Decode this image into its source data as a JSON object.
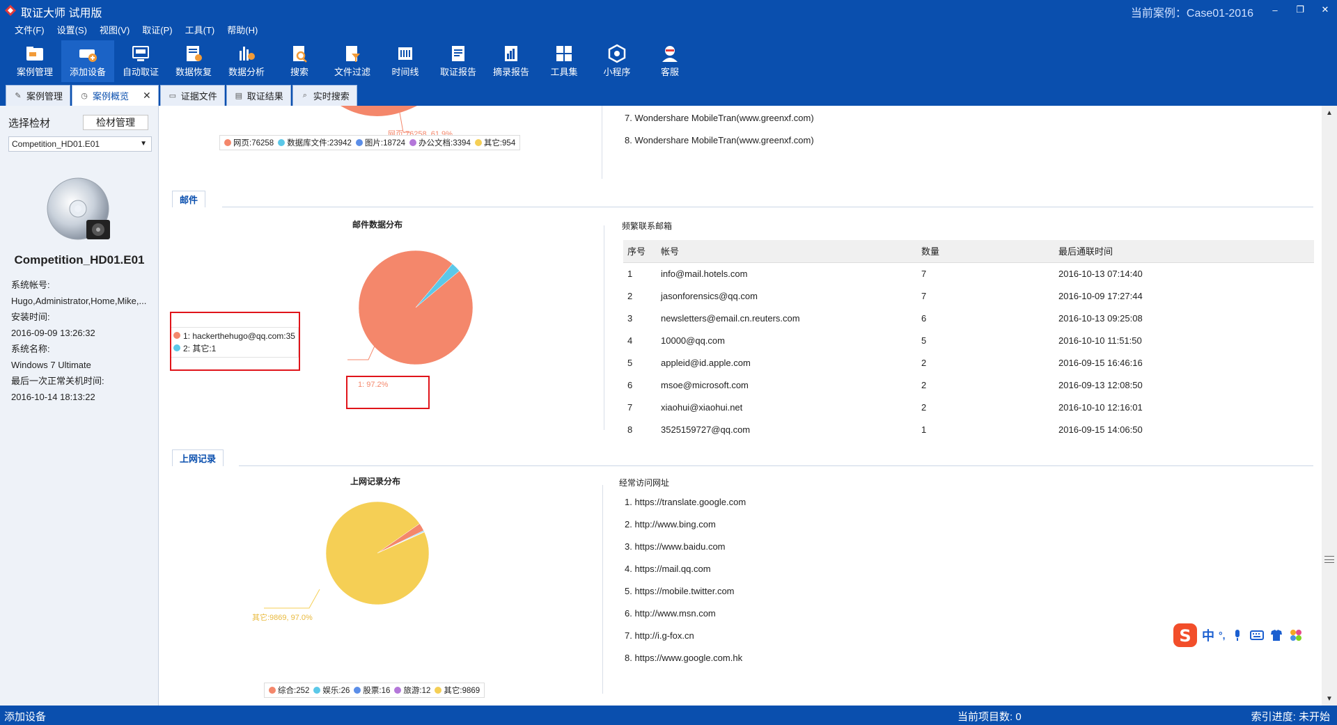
{
  "app": {
    "title": "取证大师 试用版",
    "current_case": "当前案例：Case01-2016",
    "win_buttons": {
      "minimize": "–",
      "restore": "❐",
      "close": "✕"
    }
  },
  "menu": [
    "文件(F)",
    "设置(S)",
    "视图(V)",
    "取证(P)",
    "工具(T)",
    "帮助(H)"
  ],
  "toolbar": [
    {
      "label": "案例管理",
      "icon": "case-management-icon"
    },
    {
      "label": "添加设备",
      "icon": "add-device-icon"
    },
    {
      "label": "自动取证",
      "icon": "auto-forensics-icon"
    },
    {
      "label": "数据恢复",
      "icon": "data-recovery-icon"
    },
    {
      "label": "数据分析",
      "icon": "data-analysis-icon"
    },
    {
      "label": "搜索",
      "icon": "search-icon"
    },
    {
      "label": "文件过滤",
      "icon": "file-filter-icon"
    },
    {
      "label": "时间线",
      "icon": "timeline-icon"
    },
    {
      "label": "取证报告",
      "icon": "forensics-report-icon"
    },
    {
      "label": "摘录报告",
      "icon": "excerpt-report-icon"
    },
    {
      "label": "工具集",
      "icon": "toolset-icon"
    },
    {
      "label": "小程序",
      "icon": "miniprogram-icon"
    },
    {
      "label": "客服",
      "icon": "customer-service-icon"
    }
  ],
  "tabs": [
    {
      "label": "案例管理"
    },
    {
      "label": "案例概览",
      "close": "✕"
    },
    {
      "label": "证据文件"
    },
    {
      "label": "取证结果"
    },
    {
      "label": "实时搜索"
    }
  ],
  "left": {
    "select_label": "选择检材",
    "manage_button": "检材管理",
    "dropdown_value": "Competition_HD01.E01",
    "device_name": "Competition_HD01.E01",
    "info": [
      "系统帐号:",
      "Hugo,Administrator,Home,Mike,...",
      "安装时间:",
      "2016-09-09 13:26:32",
      "系统名称:",
      "Windows 7 Ultimate",
      "最后一次正常关机时间:",
      "2016-10-14 18:13:22"
    ]
  },
  "top_partial": {
    "pie_label": "网页:76258, 61.9%",
    "legend": [
      {
        "label": "网页:76258",
        "color": "#f4876b"
      },
      {
        "label": "数据库文件:23942",
        "color": "#5bc8e8"
      },
      {
        "label": "图片:18724",
        "color": "#5b8ee8"
      },
      {
        "label": "办公文档:3394",
        "color": "#b477d9"
      },
      {
        "label": "其它:954",
        "color": "#f5cf55"
      }
    ],
    "list": [
      "7. Wondershare MobileTran(www.greenxf.com)",
      "8. Wondershare MobileTran(www.greenxf.com)"
    ]
  },
  "mail": {
    "section_tab": "邮件",
    "chart_title": "邮件数据分布",
    "list_title": "频繁联系邮箱",
    "chart_data": {
      "type": "pie",
      "categories": [
        "hackerthehugo@qq.com",
        "其它"
      ],
      "values": [
        35,
        1
      ],
      "colors": [
        "#f4876b",
        "#5bc8e8"
      ],
      "slice_label": "1: 97.2%"
    },
    "legend": [
      {
        "label": "1: hackerthehugo@qq.com:35",
        "color": "#f4876b"
      },
      {
        "label": "2: 其它:1",
        "color": "#5bc8e8"
      }
    ],
    "table": {
      "headers": [
        "序号",
        "帐号",
        "数量",
        "最后通联时间"
      ],
      "rows": [
        [
          "1",
          "info@mail.hotels.com",
          "7",
          "2016-10-13 07:14:40"
        ],
        [
          "2",
          "jasonforensics@qq.com",
          "7",
          "2016-10-09 17:27:44"
        ],
        [
          "3",
          "newsletters@email.cn.reuters.com",
          "6",
          "2016-10-13 09:25:08"
        ],
        [
          "4",
          "10000@qq.com",
          "5",
          "2016-10-10 11:51:50"
        ],
        [
          "5",
          "appleid@id.apple.com",
          "2",
          "2016-09-15 16:46:16"
        ],
        [
          "6",
          "msoe@microsoft.com",
          "2",
          "2016-09-13 12:08:50"
        ],
        [
          "7",
          "xiaohui@xiaohui.net",
          "2",
          "2016-10-10 12:16:01"
        ],
        [
          "8",
          "3525159727@qq.com",
          "1",
          "2016-09-15 14:06:50"
        ]
      ]
    }
  },
  "web": {
    "section_tab": "上网记录",
    "chart_title": "上网记录分布",
    "list_title": "经常访问网址",
    "chart_data": {
      "type": "pie",
      "categories": [
        "综合",
        "娱乐",
        "股票",
        "旅游",
        "其它"
      ],
      "values": [
        252,
        26,
        16,
        12,
        9869
      ],
      "colors": [
        "#f4876b",
        "#5bc8e8",
        "#5b8ee8",
        "#b477d9",
        "#f5cf55"
      ],
      "slice_label": "其它:9869, 97.0%"
    },
    "legend": [
      {
        "label": "综合:252",
        "color": "#f4876b"
      },
      {
        "label": "娱乐:26",
        "color": "#5bc8e8"
      },
      {
        "label": "股票:16",
        "color": "#5b8ee8"
      },
      {
        "label": "旅游:12",
        "color": "#b477d9"
      },
      {
        "label": "其它:9869",
        "color": "#f5cf55"
      }
    ],
    "urls": [
      "1. https://translate.google.com",
      "2. http://www.bing.com",
      "3. https://www.baidu.com",
      "4. https://mail.qq.com",
      "5. https://mobile.twitter.com",
      "6. http://www.msn.com",
      "7. http://i.g-fox.cn",
      "8. https://www.google.com.hk"
    ]
  },
  "ime": {
    "text": "中",
    "punct": "°,"
  },
  "status": {
    "left": "添加设备",
    "middle": "当前项目数: 0",
    "right": "索引进度: 未开始"
  },
  "colors": {
    "brand_blue": "#0a4fae",
    "highlight_red": "#e0141a"
  }
}
